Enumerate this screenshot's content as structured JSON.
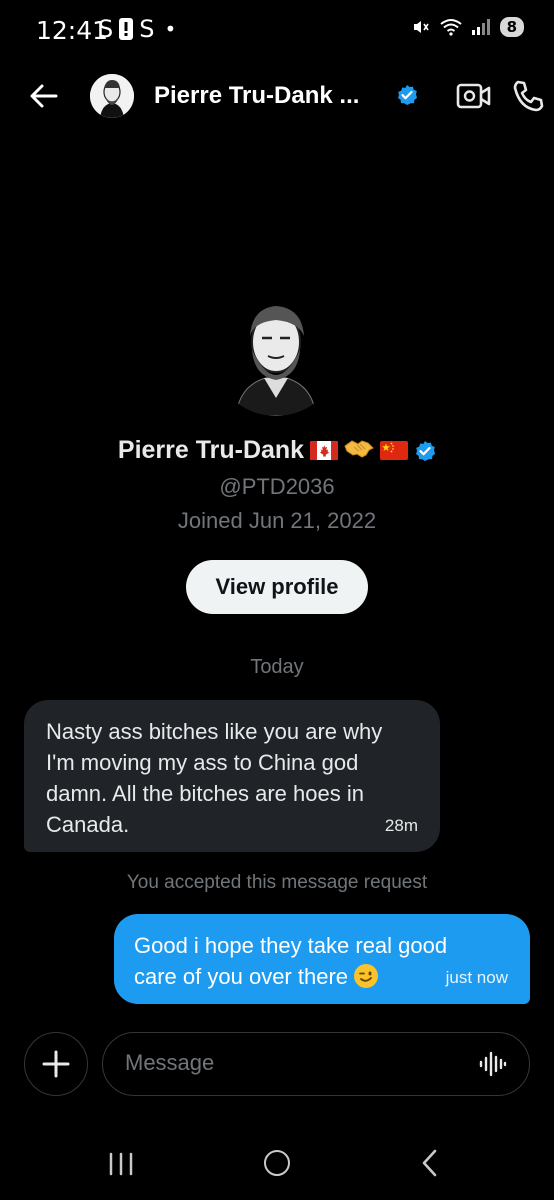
{
  "status_bar": {
    "time": "12:41",
    "left_icons": [
      "S",
      "alert-icon",
      "S",
      "dot"
    ],
    "battery": "8"
  },
  "header": {
    "name": "Pierre Tru-Dank ...",
    "verified": true
  },
  "profile": {
    "name": "Pierre Tru-Dank",
    "emoji_after_name": [
      "canada-flag-icon",
      "handshake-icon",
      "china-flag-icon"
    ],
    "handle": "@PTD2036",
    "joined": "Joined Jun 21, 2022",
    "view_profile_label": "View profile"
  },
  "conversation": {
    "date_label": "Today",
    "messages": [
      {
        "direction": "incoming",
        "text": "Nasty ass bitches like you are why I'm moving my ass to China god damn. All the bitches are hoes in Canada.",
        "time": "28m"
      },
      {
        "direction": "outgoing",
        "text": "Good i hope they take real good care of you over there",
        "emoji": "winking-face-icon",
        "time": "just now"
      }
    ],
    "system_note": "You accepted this message request"
  },
  "composer": {
    "placeholder": "Message"
  },
  "colors": {
    "background": "#000000",
    "accent": "#1d9bf0",
    "incoming_bubble": "#202327",
    "muted_text": "#71767b"
  }
}
